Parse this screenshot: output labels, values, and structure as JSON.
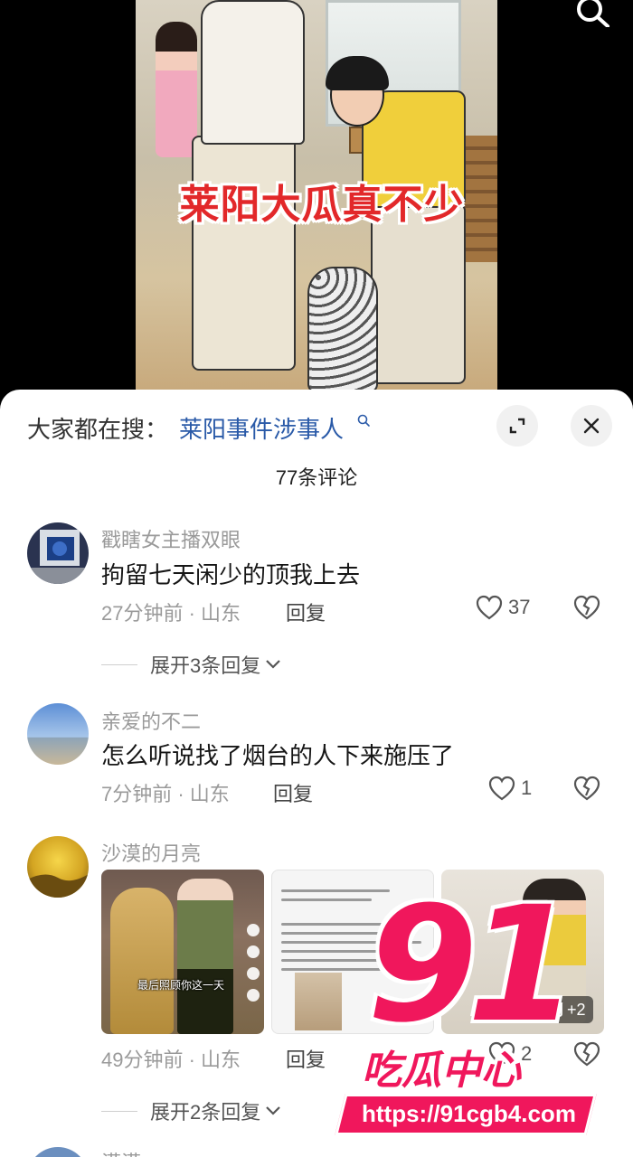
{
  "video": {
    "caption": "莱阳大瓜真不少"
  },
  "hot_search": {
    "prefix": "大家都在搜：",
    "term": "莱阳事件涉事人"
  },
  "comments_header": {
    "count_label": "77条评论"
  },
  "comments": [
    {
      "username": "戳瞎女主播双眼",
      "text": "拘留七天闲少的顶我上去",
      "time": "27分钟前 · 山东",
      "reply_label": "回复",
      "likes": "37",
      "expand_label": "展开3条回复"
    },
    {
      "username": "亲爱的不二",
      "text": "怎么听说找了烟台的人下来施压了",
      "time": "7分钟前 · 山东",
      "reply_label": "回复",
      "likes": "1"
    },
    {
      "username": "沙漠的月亮",
      "time": "49分钟前 · 山东",
      "reply_label": "回复",
      "likes": "2",
      "expand_label": "展开2条回复",
      "image_caption": "最后照顾你这一天",
      "more_images": "+2"
    }
  ],
  "next_comment_partial": {
    "username": "满满"
  },
  "watermark": {
    "logo_number": "91",
    "logo_text": "吃瓜中心",
    "url": "https://91cgb4.com"
  },
  "colors": {
    "accent_blue": "#2a5aa8",
    "watermark_pink": "#f0175c",
    "caption_red": "#e2282a"
  },
  "icons": [
    "search-icon",
    "magnifier-icon",
    "expand-icon",
    "close-icon",
    "heart-icon",
    "broken-heart-icon",
    "chevron-down-icon",
    "image-icon"
  ]
}
